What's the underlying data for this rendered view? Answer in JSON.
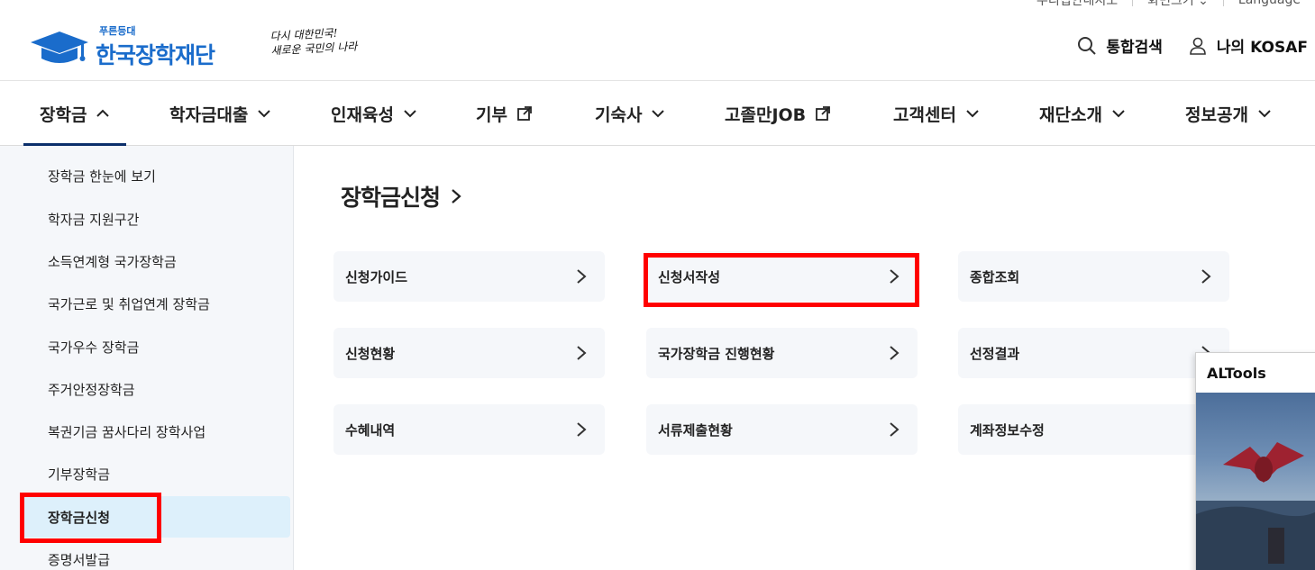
{
  "util_bar": {
    "items": [
      "우리집안내지도",
      "화면크기",
      "Language"
    ]
  },
  "header": {
    "logo_small": "푸른등대",
    "logo_big": "한국장학재단",
    "slogan_line1": "다시 대한민국!",
    "slogan_line2": "새로운 국민의 나라",
    "search_label": "통합검색",
    "my_label": "나의 KOSAF"
  },
  "gnb": {
    "items": [
      {
        "label": "장학금",
        "active": true
      },
      {
        "label": "학자금대출"
      },
      {
        "label": "인재육성"
      },
      {
        "label": "기부"
      },
      {
        "label": "기숙사"
      },
      {
        "label": "고졸만JOB"
      },
      {
        "label": "고객센터"
      },
      {
        "label": "재단소개"
      },
      {
        "label": "정보공개"
      }
    ]
  },
  "sidebar": {
    "items": [
      {
        "label": "장학금 한눈에 보기"
      },
      {
        "label": "학자금 지원구간"
      },
      {
        "label": "소득연계형 국가장학금"
      },
      {
        "label": "국가근로 및 취업연계 장학금"
      },
      {
        "label": "국가우수 장학금"
      },
      {
        "label": "주거안정장학금"
      },
      {
        "label": "복권기금 꿈사다리 장학사업"
      },
      {
        "label": "기부장학금"
      },
      {
        "label": "장학금신청",
        "active": true
      },
      {
        "label": "증명서발급"
      }
    ]
  },
  "main": {
    "title": "장학금신청",
    "cards": [
      {
        "label": "신청가이드"
      },
      {
        "label": "신청서작성",
        "highlighted": true
      },
      {
        "label": "종합조회"
      },
      {
        "label": "신청현황"
      },
      {
        "label": "국가장학금 진행현황"
      },
      {
        "label": "선정결과"
      },
      {
        "label": "수혜내역"
      },
      {
        "label": "서류제출현황"
      },
      {
        "label": "계좌정보수정"
      }
    ]
  },
  "popup": {
    "title": "ALTools"
  },
  "colors": {
    "brand_blue": "#1a6ccb",
    "gnb_active": "#0b2f6b",
    "highlight_red": "#ff0000",
    "sidebar_bg": "#f5f7fa",
    "sidebar_active_bg": "#ddf0fb"
  }
}
